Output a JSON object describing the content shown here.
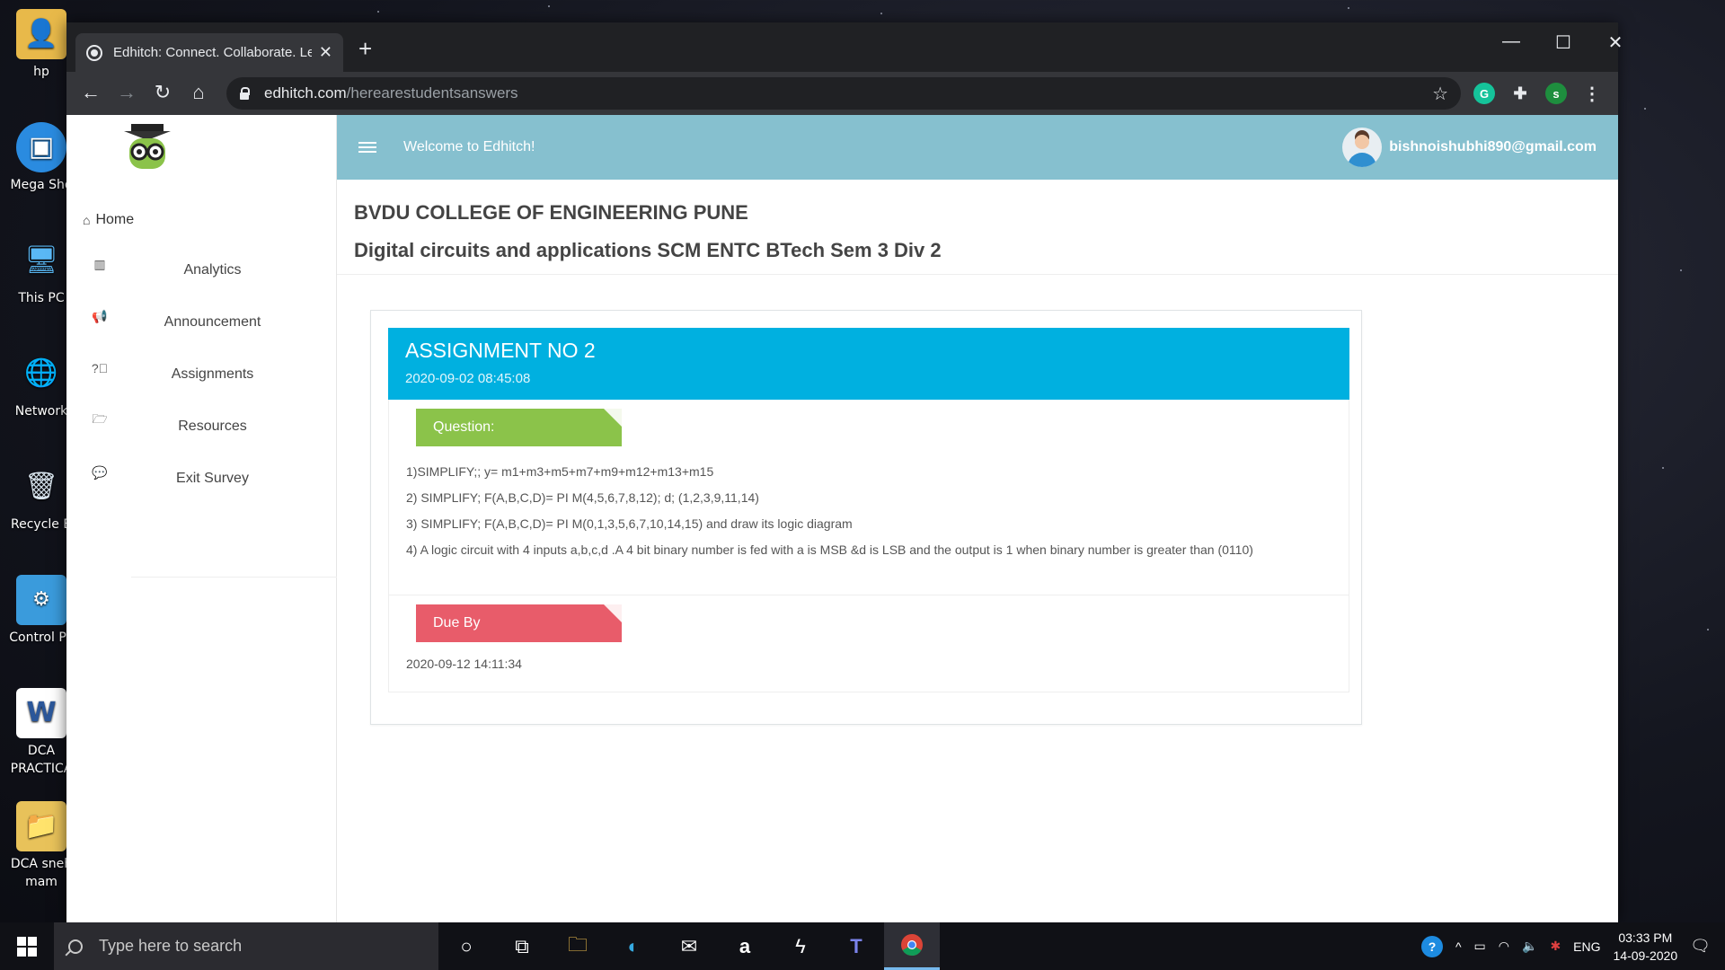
{
  "desktop": {
    "icons": [
      {
        "label": "hp",
        "icon": "user-folder-icon"
      },
      {
        "label": "Mega Sho",
        "icon": "tv-icon"
      },
      {
        "label": "This PC",
        "icon": "computer-icon"
      },
      {
        "label": "Network",
        "icon": "network-icon"
      },
      {
        "label": "Recycle B",
        "icon": "recycle-bin-icon"
      },
      {
        "label": "Control Pa",
        "icon": "control-panel-icon"
      },
      {
        "label": "DCA\nPRACTICA",
        "icon": "word-document-icon"
      },
      {
        "label": "DCA sneh\nmam",
        "icon": "folder-icon"
      }
    ]
  },
  "browser": {
    "tab_title": "Edhitch: Connect. Collaborate. Le",
    "url_domain": "edhitch.com",
    "url_path": "/herearestudentsanswers",
    "profile_initial": "s",
    "colors": {
      "titlebar": "#202124",
      "toolbar": "#35363a"
    }
  },
  "app": {
    "welcome": "Welcome to Edhitch!",
    "user_email": "bishnoishubhi890@gmail.com",
    "sidebar": {
      "home": "Home",
      "items": [
        {
          "label": "Analytics",
          "icon": "bar-chart-icon"
        },
        {
          "label": "Announcement",
          "icon": "megaphone-icon"
        },
        {
          "label": "Assignments",
          "icon": "question-circle-icon"
        },
        {
          "label": "Resources",
          "icon": "folder-open-icon"
        },
        {
          "label": "Exit Survey",
          "icon": "chat-bubbles-icon"
        }
      ]
    },
    "college": "BVDU COLLEGE OF ENGINEERING PUNE",
    "course": "Digital circuits and applications SCM ENTC BTech Sem 3 Div 2",
    "assignment": {
      "title": "ASSIGNMENT NO 2",
      "created": "2020-09-02 08:45:08",
      "question_label": "Question:",
      "questions": [
        "1)SIMPLIFY;; y= m1+m3+m5+m7+m9+m12+m13+m15",
        "2) SIMPLIFY; F(A,B,C,D)= PI M(4,5,6,7,8,12); d; (1,2,3,9,11,14)",
        "3) SIMPLIFY; F(A,B,C,D)= PI M(0,1,3,5,6,7,10,14,15) and draw its logic diagram",
        "4) A logic circuit with 4 inputs a,b,c,d .A 4 bit binary number is fed with a is MSB &d is LSB and the output is 1 when binary number is greater than (0110)"
      ],
      "due_label": "Due By",
      "due_date": "2020-09-12 14:11:34",
      "colors": {
        "header": "#00b0e0",
        "question_ribbon": "#8bc34a",
        "due_ribbon": "#e85c6a",
        "app_header": "#86c0cf"
      }
    }
  },
  "taskbar": {
    "search_placeholder": "Type here to search",
    "language": "ENG",
    "time": "03:33 PM",
    "date": "14-09-2020"
  }
}
